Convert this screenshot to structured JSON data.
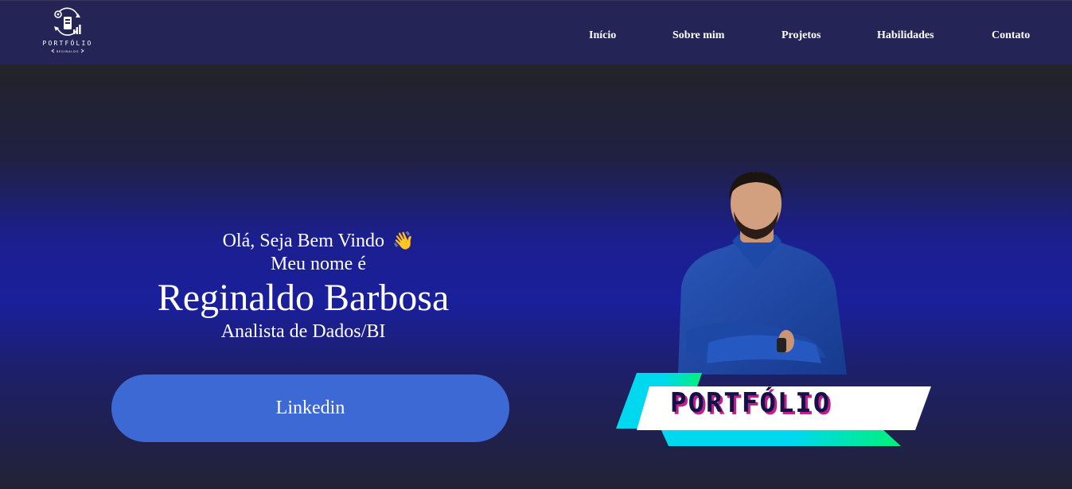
{
  "logo": {
    "title": "PORTFÓLIO",
    "subtitle": "REGINALDO"
  },
  "nav": {
    "items": [
      {
        "label": "Início"
      },
      {
        "label": "Sobre mim"
      },
      {
        "label": "Projetos"
      },
      {
        "label": "Habilidades"
      },
      {
        "label": "Contato"
      }
    ]
  },
  "hero": {
    "greeting": "Olá, Seja Bem Vindo",
    "greeting_emoji": "👋",
    "intro": "Meu nome é",
    "name": "Reginaldo Barbosa",
    "role": "Analista de Dados/BI",
    "linkedin_label": "Linkedin"
  },
  "portrait_banner": {
    "label": "PORTFÓLIO"
  },
  "colors": {
    "navbar": "#242457",
    "hero_blue": "#1a1f9c",
    "button": "#3d69d4",
    "banner_cyan": "#00d8f0",
    "banner_green": "#00f07a",
    "banner_text": "#15104a",
    "banner_text_shadow": "#c0208a"
  }
}
